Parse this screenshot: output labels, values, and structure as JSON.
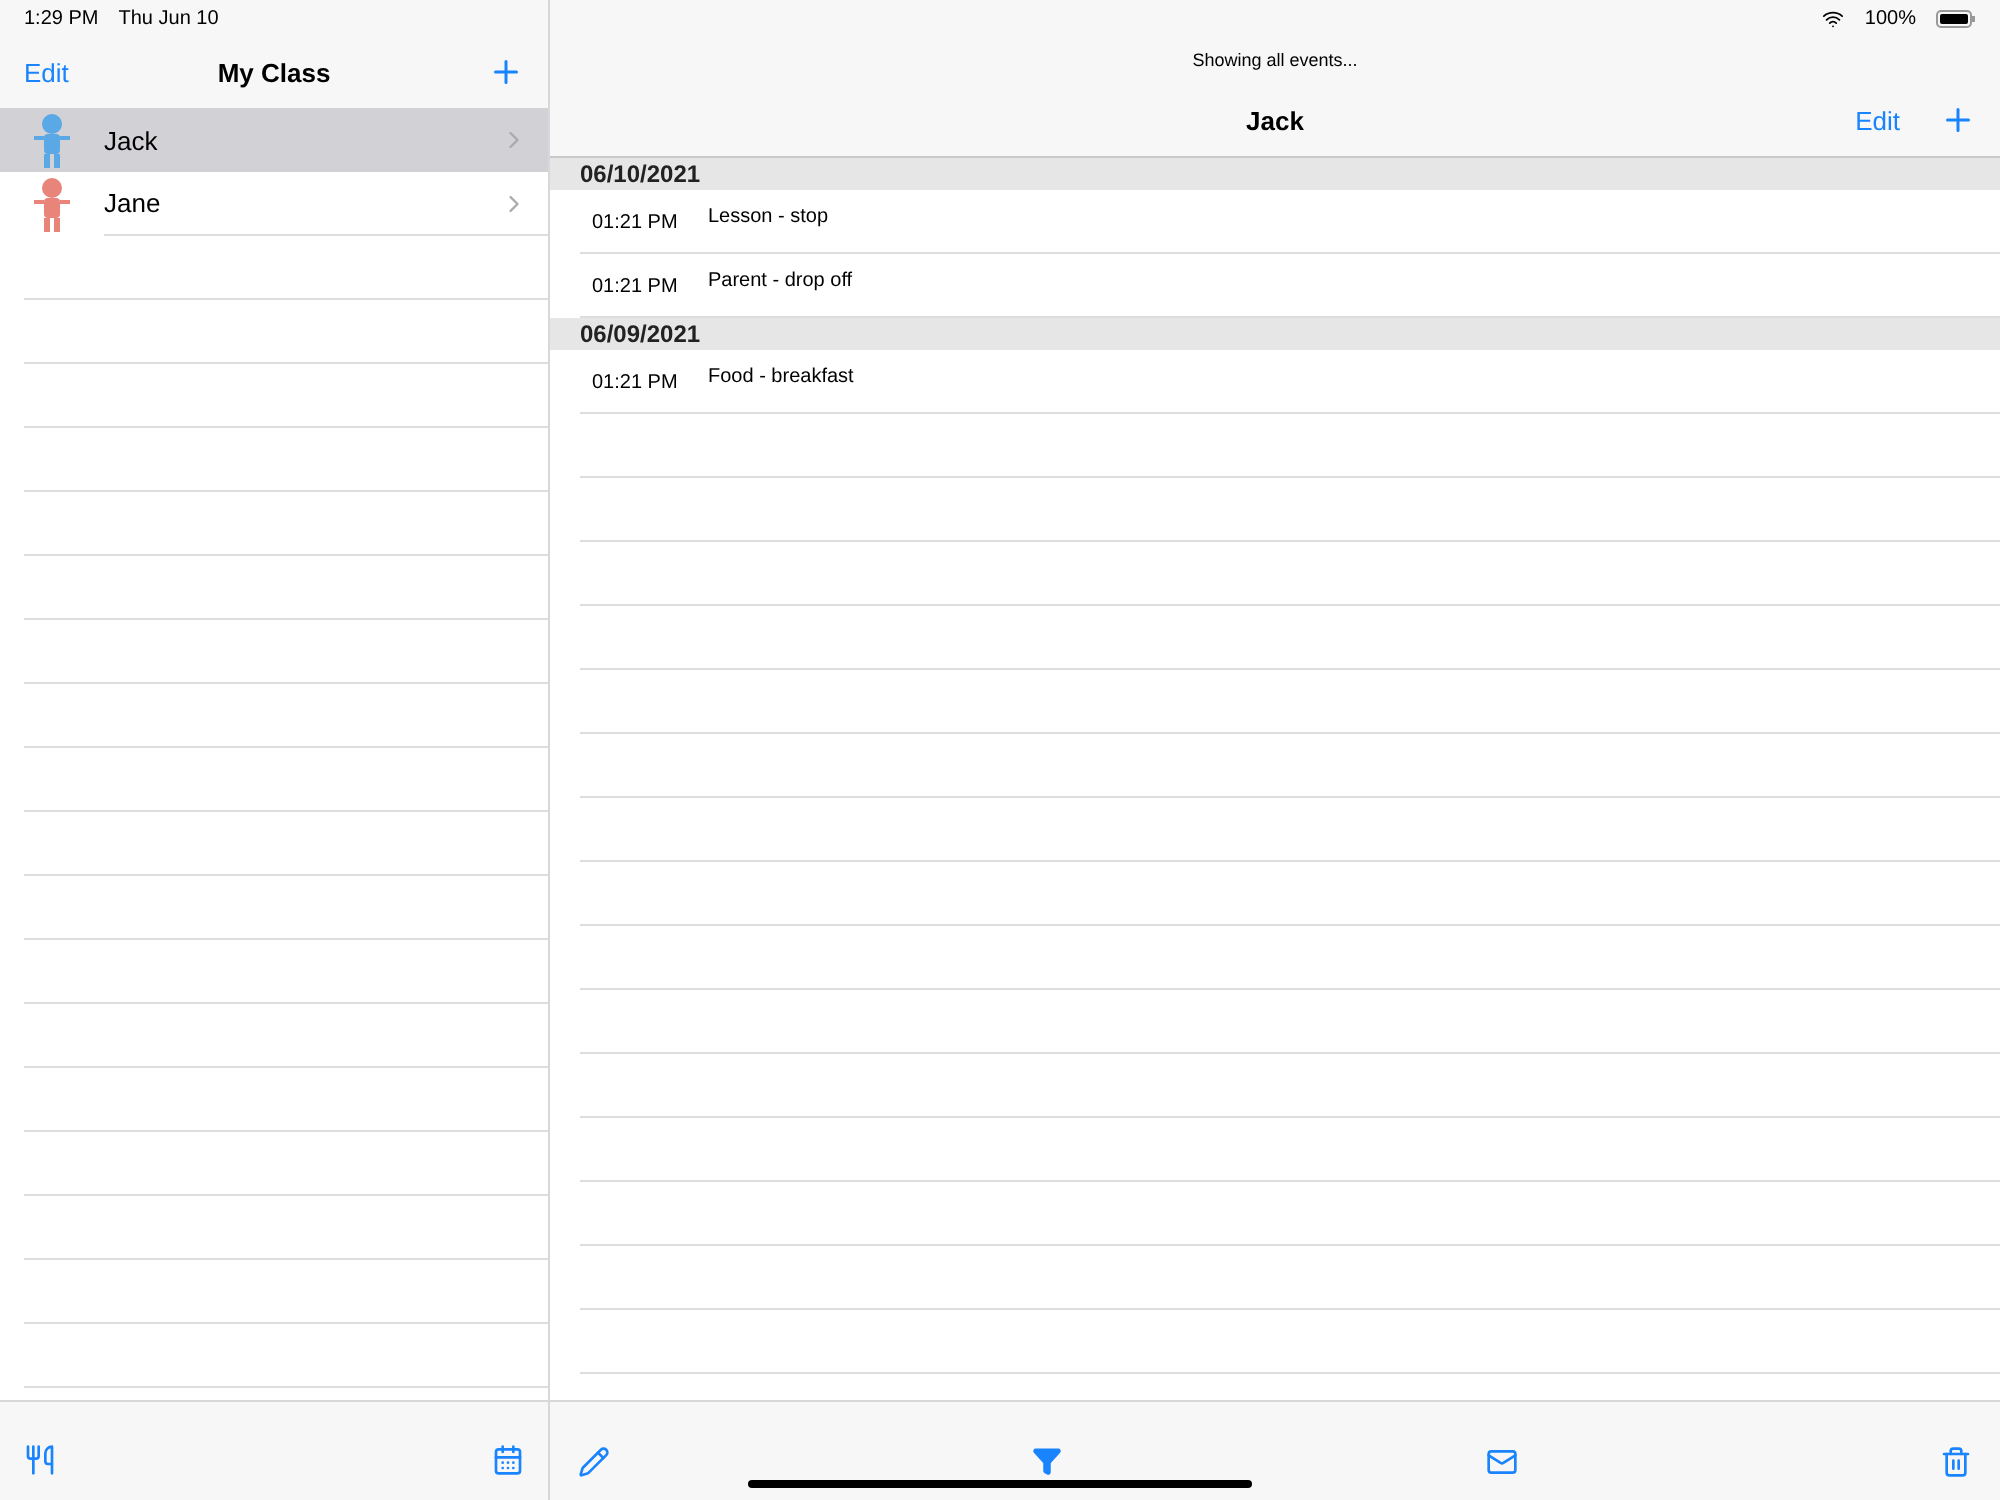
{
  "status_bar": {
    "time": "1:29 PM",
    "date": "Thu Jun 10",
    "battery": "100%"
  },
  "sidebar": {
    "edit": "Edit",
    "title": "My Class",
    "students": [
      {
        "name": "Jack",
        "selected": true,
        "color": "#5aa8e6"
      },
      {
        "name": "Jane",
        "selected": false,
        "color": "#e8847a"
      }
    ]
  },
  "detail": {
    "filter_note": "Showing all events...",
    "title": "Jack",
    "edit": "Edit",
    "sections": [
      {
        "date": "06/10/2021",
        "events": [
          {
            "time": "01:21 PM",
            "text": "Lesson - stop"
          },
          {
            "time": "01:21 PM",
            "text": "Parent - drop off"
          }
        ]
      },
      {
        "date": "06/09/2021",
        "events": [
          {
            "time": "01:21 PM",
            "text": "Food - breakfast"
          }
        ]
      }
    ]
  }
}
